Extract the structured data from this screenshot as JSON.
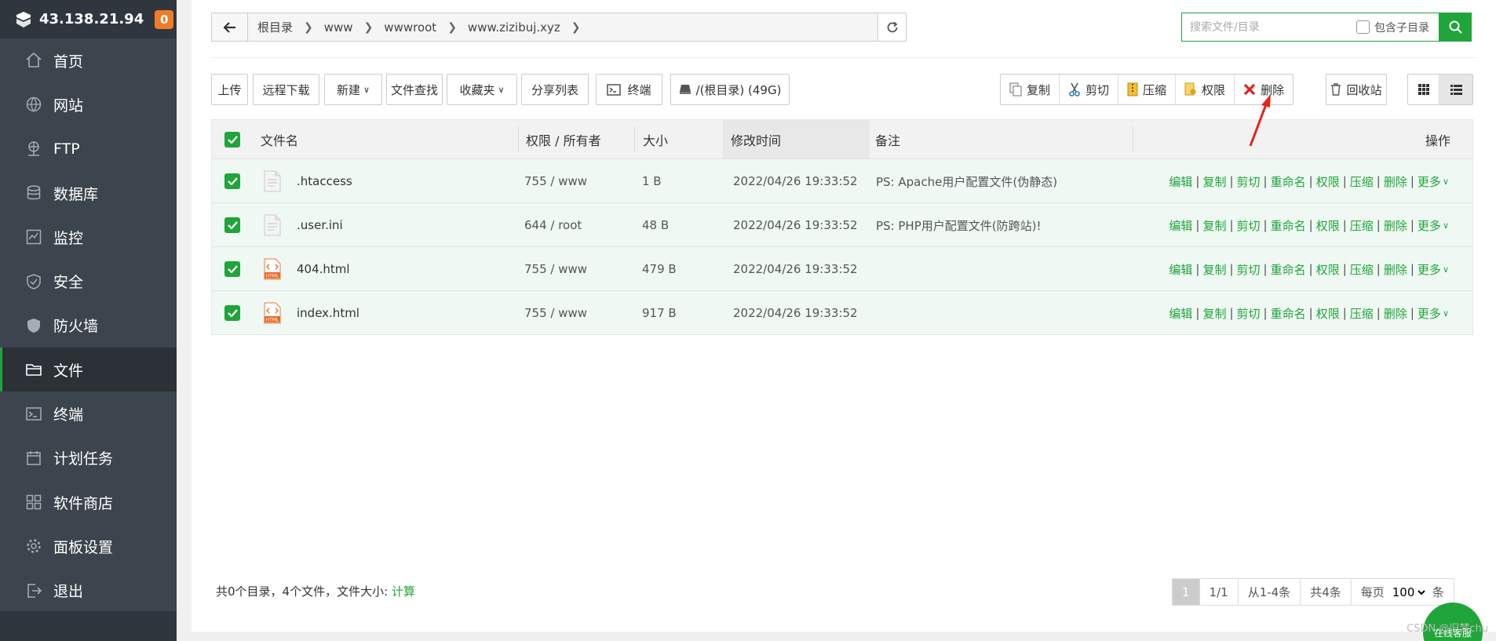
{
  "sidebar": {
    "ip": "43.138.21.94",
    "badge": "0",
    "items": [
      {
        "label": "首页",
        "icon": "home-icon"
      },
      {
        "label": "网站",
        "icon": "globe-icon"
      },
      {
        "label": "FTP",
        "icon": "ftp-icon"
      },
      {
        "label": "数据库",
        "icon": "database-icon"
      },
      {
        "label": "监控",
        "icon": "monitor-icon"
      },
      {
        "label": "安全",
        "icon": "shield-icon"
      },
      {
        "label": "防火墙",
        "icon": "firewall-icon"
      },
      {
        "label": "文件",
        "icon": "folder-icon"
      },
      {
        "label": "终端",
        "icon": "terminal-icon"
      },
      {
        "label": "计划任务",
        "icon": "calendar-icon"
      },
      {
        "label": "软件商店",
        "icon": "apps-icon"
      },
      {
        "label": "面板设置",
        "icon": "gear-icon"
      },
      {
        "label": "退出",
        "icon": "logout-icon"
      }
    ],
    "active": "文件"
  },
  "path": {
    "segments": [
      "根目录",
      "www",
      "wwwroot",
      "www.zizibuj.xyz"
    ]
  },
  "search": {
    "placeholder": "搜索文件/目录",
    "subdir_label": "包含子目录"
  },
  "toolbar": {
    "upload": "上传",
    "remote_download": "远程下载",
    "new": "新建",
    "find": "文件查找",
    "favorites": "收藏夹",
    "share_list": "分享列表",
    "terminal": "终端",
    "disk": "/(根目录) (49G)",
    "copy": "复制",
    "cut": "剪切",
    "compress": "压缩",
    "permission": "权限",
    "delete": "删除",
    "recycle": "回收站"
  },
  "table": {
    "headers": {
      "name": "文件名",
      "perm": "权限 / 所有者",
      "size": "大小",
      "mtime": "修改时间",
      "note": "备注",
      "ops": "操作"
    },
    "rows": [
      {
        "name": ".htaccess",
        "type": "file",
        "perm": "755 / www",
        "size": "1 B",
        "mtime": "2022/04/26 19:33:52",
        "note": "PS: Apache用户配置文件(伪静态)"
      },
      {
        "name": ".user.ini",
        "type": "file",
        "perm": "644 / root",
        "size": "48 B",
        "mtime": "2022/04/26 19:33:52",
        "note": "PS: PHP用户配置文件(防跨站)!"
      },
      {
        "name": "404.html",
        "type": "html",
        "perm": "755 / www",
        "size": "479 B",
        "mtime": "2022/04/26 19:33:52",
        "note": ""
      },
      {
        "name": "index.html",
        "type": "html",
        "perm": "755 / www",
        "size": "917 B",
        "mtime": "2022/04/26 19:33:52",
        "note": ""
      }
    ],
    "row_ops": [
      "编辑",
      "复制",
      "剪切",
      "重命名",
      "权限",
      "压缩",
      "删除",
      "更多"
    ]
  },
  "footer": {
    "summary": "共0个目录，4个文件，文件大小: ",
    "calc": "计算",
    "page_current": "1",
    "page_total": "1/1",
    "range": "从1-4条",
    "count": "共4条",
    "per_page_label": "每页",
    "per_page": "100",
    "unit": "条"
  },
  "watermark": "CSDN @旧梦chu",
  "float_label": "在线客服",
  "colors": {
    "accent": "#20a53a",
    "sidebar": "#3c444d",
    "row_selected": "#eff8f3"
  }
}
